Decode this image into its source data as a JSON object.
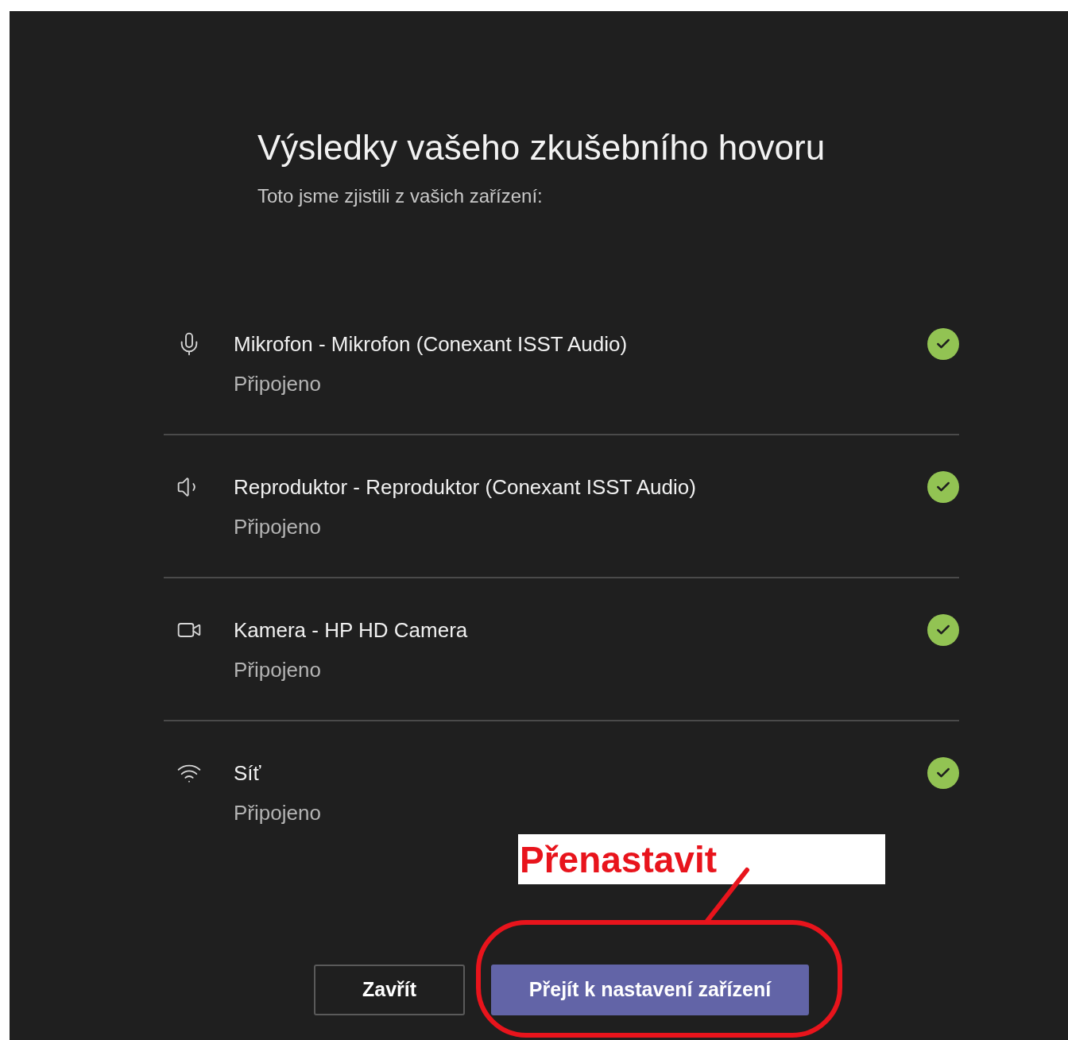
{
  "dialog": {
    "title": "Výsledky vašeho zkušebního hovoru",
    "subtitle": "Toto jsme zjistili z vašich zařízení:"
  },
  "devices": [
    {
      "kind": "microphone",
      "name": "Mikrofon - Mikrofon (Conexant ISST Audio)",
      "status": "Připojeno",
      "ok": true
    },
    {
      "kind": "speaker",
      "name": "Reproduktor - Reproduktor (Conexant ISST Audio)",
      "status": "Připojeno",
      "ok": true
    },
    {
      "kind": "camera",
      "name": "Kamera - HP HD Camera",
      "status": "Připojeno",
      "ok": true
    },
    {
      "kind": "network",
      "name": "Síť",
      "status": "Připojeno",
      "ok": true
    }
  ],
  "buttons": [
    {
      "label": "Zavřít",
      "kind": "secondary"
    },
    {
      "label": "Přejít k nastavení zařízení",
      "kind": "primary"
    }
  ],
  "annotation": {
    "text": "Přenastavit"
  }
}
